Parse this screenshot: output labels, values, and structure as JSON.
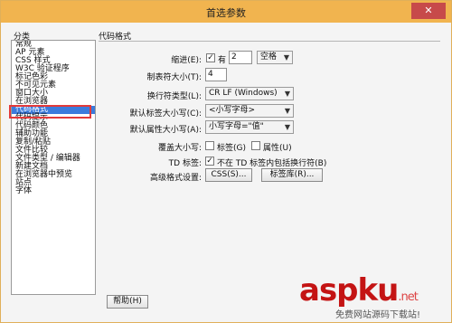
{
  "window": {
    "title": "首选参数",
    "close_label": "✕"
  },
  "categories": {
    "label": "分类",
    "items": [
      "常规",
      "AP 元素",
      "CSS 样式",
      "W3C 验证程序",
      "标记色彩",
      "不可见元素",
      "窗口大小",
      "在浏览器",
      "代码格式",
      "代码提示",
      "代码颜色",
      "辅助功能",
      "复制/粘贴",
      "文件比较",
      "文件类型 / 编辑器",
      "新建文档",
      "在浏览器中预览",
      "站点",
      "字体"
    ],
    "selected_index": 8
  },
  "section": {
    "title": "代码格式"
  },
  "indent": {
    "label": "缩进(E):",
    "checkbox_label": "有",
    "checked": true,
    "value": "2",
    "unit": "空格"
  },
  "tab_size": {
    "label": "制表符大小(T):",
    "value": "4"
  },
  "line_break": {
    "label": "换行符类型(L):",
    "value": "CR LF (Windows)"
  },
  "tag_case": {
    "label": "默认标签大小写(C):",
    "value": "<小写字母>"
  },
  "attr_case": {
    "label": "默认属性大小写(A):",
    "value": "小写字母=\"值\""
  },
  "override_case": {
    "label": "覆盖大小写:",
    "tag_label": "标签(G)",
    "attr_label": "属性(U)"
  },
  "td_tag": {
    "label": "TD 标签:",
    "checkbox_label": "不在 TD 标签内包括换行符(B)",
    "checked": true
  },
  "advanced": {
    "label": "高级格式设置:",
    "css_button": "CSS(S)...",
    "taglib_button": "标签库(R)..."
  },
  "help_button": "帮助(H)",
  "watermark": {
    "brand": "aspku",
    "suffix": ".net",
    "tagline": "免费网站源码下载站!"
  }
}
